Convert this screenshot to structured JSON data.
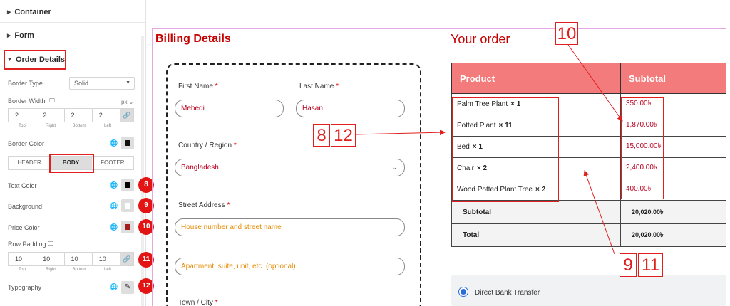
{
  "panel": {
    "sections": {
      "container": "Container",
      "form": "Form",
      "order_details": "Order Details"
    },
    "border_type_label": "Border Type",
    "border_type_value": "Solid",
    "border_width_label": "Border Width",
    "unit": "px",
    "border_width": {
      "top": "2",
      "right": "2",
      "bottom": "2",
      "left": "2"
    },
    "dim_labels": {
      "top": "Top",
      "right": "Right",
      "bottom": "Bottom",
      "left": "Left"
    },
    "border_color_label": "Border Color",
    "tabs": {
      "header": "HEADER",
      "body": "BODY",
      "footer": "FOOTER"
    },
    "text_color_label": "Text Color",
    "background_label": "Background",
    "price_color_label": "Price Color",
    "row_padding_label": "Row Padding",
    "row_padding": {
      "top": "10",
      "right": "10",
      "bottom": "10",
      "left": "10"
    },
    "typography_label": "Typography",
    "badges": {
      "text_color": "8",
      "background": "9",
      "price_color": "10",
      "row_padding": "11",
      "typography": "12"
    },
    "colors": {
      "border_color": "#111111",
      "text_color": "#000000",
      "background": "#ffffff",
      "price_color": "#a21f1f"
    }
  },
  "billing": {
    "title": "Billing Details",
    "first_name_label": "First Name",
    "first_name_value": "Mehedi",
    "last_name_label": "Last Name",
    "last_name_value": "Hasan",
    "required_mark": "*",
    "country_label": "Country / Region",
    "country_value": "Bangladesh",
    "street_label": "Street Address",
    "street_placeholder": "House number and street name",
    "apartment_placeholder": "Apartment, suite, unit, etc. (optional)",
    "town_label": "Town / City"
  },
  "order": {
    "title": "Your order",
    "header_product": "Product",
    "header_subtotal": "Subtotal",
    "items": [
      {
        "name": "Palm Tree Plant",
        "qty": "× 1",
        "price": "350.00৳"
      },
      {
        "name": "Potted Plant",
        "qty": "× 11",
        "price": "1,870.00৳"
      },
      {
        "name": "Bed",
        "qty": "× 1",
        "price": "15,000.00৳"
      },
      {
        "name": "Chair",
        "qty": "× 2",
        "price": "2,400.00৳"
      },
      {
        "name": "Wood Potted Plant Tree",
        "qty": "× 2",
        "price": "400.00৳"
      }
    ],
    "subtotal_label": "Subtotal",
    "subtotal_value": "20,020.00৳",
    "total_label": "Total",
    "total_value": "20,020.00৳"
  },
  "payment": {
    "direct_bank_transfer": "Direct Bank Transfer"
  },
  "annotations": {
    "a10": "10",
    "a8": "8",
    "a12": "12",
    "a9": "9",
    "a11": "11"
  }
}
